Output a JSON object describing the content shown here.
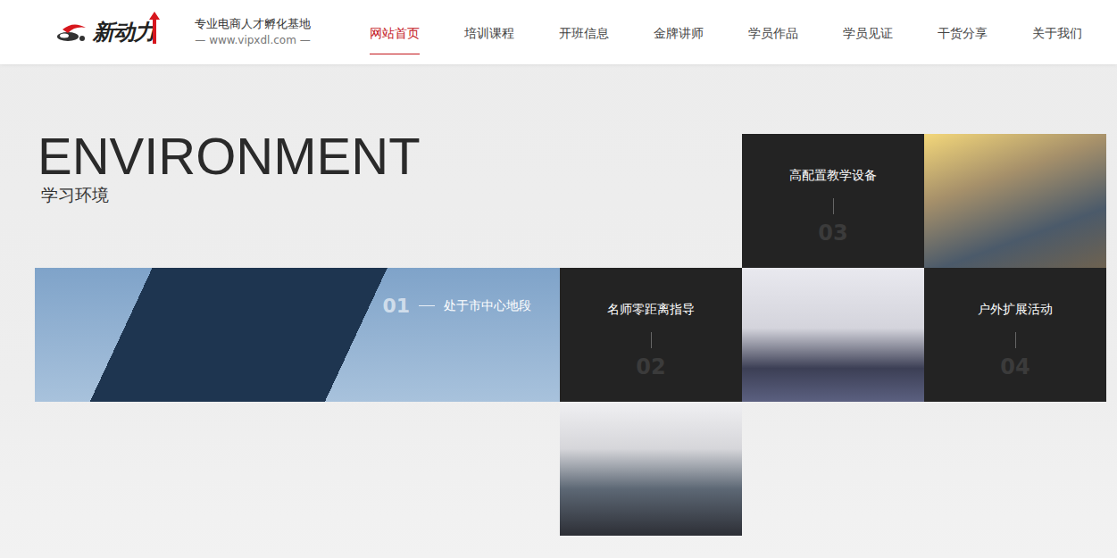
{
  "header": {
    "logo": "新动力",
    "tagline": "专业电商人才孵化基地",
    "url": "— www.vipxdl.com —"
  },
  "nav": [
    {
      "label": "网站首页",
      "selected": true
    },
    {
      "label": "培训课程",
      "selected": false
    },
    {
      "label": "开班信息",
      "selected": false
    },
    {
      "label": "金牌讲师",
      "selected": false
    },
    {
      "label": "学员作品",
      "selected": false
    },
    {
      "label": "学员见证",
      "selected": false
    },
    {
      "label": "干货分享",
      "selected": false
    },
    {
      "label": "关于我们",
      "selected": false
    }
  ],
  "section": {
    "title": "ENVIRONMENT",
    "subtitle": "学习环境"
  },
  "tiles": [
    {
      "kind": "feature",
      "label": "高配置教学设备",
      "number": "03"
    },
    {
      "kind": "photo"
    },
    {
      "kind": "hero",
      "label": "处于市中心地段",
      "number": "01"
    },
    {
      "kind": "feature",
      "label": "名师零距离指导",
      "number": "02"
    },
    {
      "kind": "photo"
    },
    {
      "kind": "feature",
      "label": "户外扩展活动",
      "number": "04"
    },
    {
      "kind": "photo"
    }
  ]
}
